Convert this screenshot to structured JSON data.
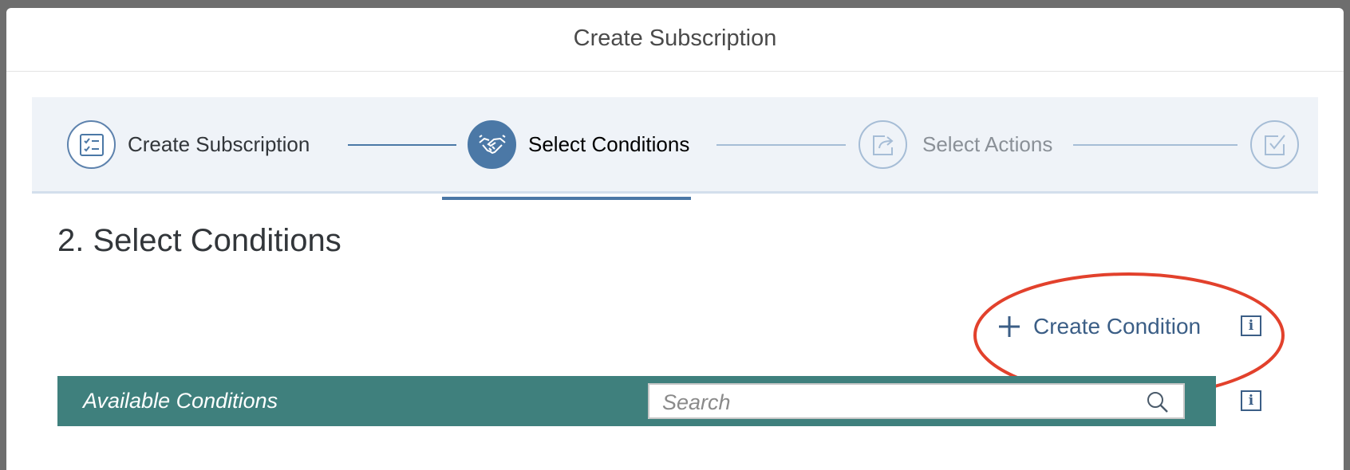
{
  "dialog": {
    "title": "Create Subscription"
  },
  "wizard": {
    "steps": [
      {
        "label": "Create Subscription",
        "icon": "checklist-icon",
        "state": "completed"
      },
      {
        "label": "Select Conditions",
        "icon": "handshake-icon",
        "state": "active"
      },
      {
        "label": "Select Actions",
        "icon": "share-arrow-icon",
        "state": "future"
      },
      {
        "label": "",
        "icon": "checkbox-icon",
        "state": "future"
      }
    ]
  },
  "section": {
    "title": "2. Select Conditions"
  },
  "toolbar": {
    "create_condition_label": "Create Condition",
    "info_icon": "info-icon"
  },
  "available_conditions": {
    "title": "Available Conditions",
    "search_placeholder": "Search",
    "search_value": ""
  },
  "colors": {
    "accent_blue": "#4b78a6",
    "link_blue": "#3b5e86",
    "bar_teal": "#3f807d",
    "highlight_red": "#e2412c",
    "wizard_bg": "#eff3f8"
  }
}
